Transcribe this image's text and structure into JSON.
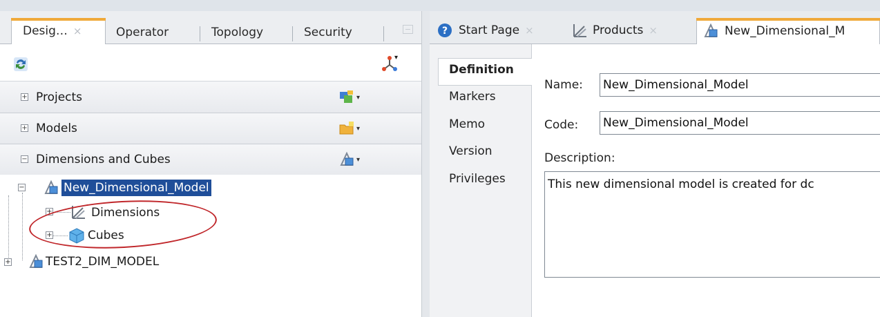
{
  "left_panel": {
    "tabs": [
      {
        "label": "Desig…",
        "close": "×"
      },
      {
        "label": "Operator"
      },
      {
        "label": "Topology"
      },
      {
        "label": "Security"
      }
    ],
    "accordion": [
      {
        "toggle": "+",
        "label": "Projects"
      },
      {
        "toggle": "+",
        "label": "Models"
      },
      {
        "toggle": "−",
        "label": "Dimensions and Cubes"
      }
    ],
    "dropdown_glyph": "▾",
    "tree": {
      "root_toggle": "−",
      "root": "New_Dimensional_Model",
      "children": [
        {
          "toggle": "+",
          "label": "Dimensions"
        },
        {
          "toggle": "+",
          "label": "Cubes"
        }
      ],
      "second_toggle": "+",
      "second": "TEST2_DIM_MODEL"
    },
    "colors": {
      "selection": "#1f4e99",
      "annotation": "#c0262a",
      "active_tab_accent": "#f0a93a"
    }
  },
  "right_panel": {
    "tabs": [
      {
        "label": "Start Page",
        "close": "×",
        "icon": "help-icon"
      },
      {
        "label": "Products",
        "close": "×",
        "icon": "dimension-icon"
      },
      {
        "label": "New_Dimensional_M",
        "icon": "dimensional-model-icon"
      }
    ],
    "side_tabs": [
      "Definition",
      "Markers",
      "Memo",
      "Version",
      "Privileges"
    ],
    "form": {
      "name_label": "Name:",
      "name_value": "New_Dimensional_Model",
      "code_label": "Code:",
      "code_value": "New_Dimensional_Model",
      "description_label": "Description:",
      "description_value": "This new dimensional model is created for dc"
    }
  }
}
